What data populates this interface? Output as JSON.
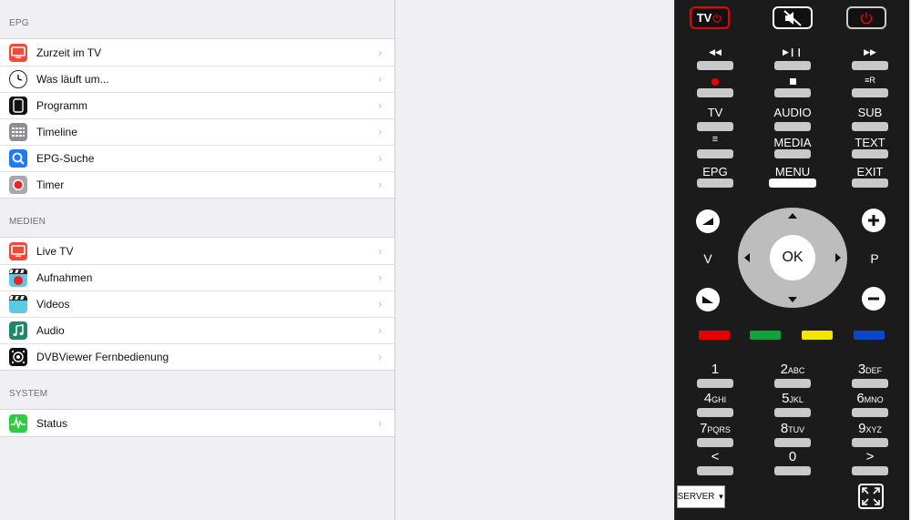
{
  "sections": [
    {
      "header": "EPG",
      "items": [
        {
          "label": "Zurzeit im TV",
          "icon": "tv-icon"
        },
        {
          "label": "Was läuft um...",
          "icon": "clock-icon"
        },
        {
          "label": "Programm",
          "icon": "program-icon"
        },
        {
          "label": "Timeline",
          "icon": "timeline-icon"
        },
        {
          "label": "EPG-Suche",
          "icon": "search-icon"
        },
        {
          "label": "Timer",
          "icon": "record-icon"
        }
      ]
    },
    {
      "header": "MEDIEN",
      "items": [
        {
          "label": "Live TV",
          "icon": "tv-icon"
        },
        {
          "label": "Aufnahmen",
          "icon": "clapper-record-icon"
        },
        {
          "label": "Videos",
          "icon": "clapper-icon"
        },
        {
          "label": "Audio",
          "icon": "music-note-icon"
        },
        {
          "label": "DVBViewer Fernbedienung",
          "icon": "remote-icon"
        }
      ]
    },
    {
      "header": "SYSTEM",
      "items": [
        {
          "label": "Status",
          "icon": "status-icon"
        }
      ]
    }
  ],
  "remote": {
    "tv_power_label": "TV",
    "rows": {
      "row1": [
        "",
        "",
        ""
      ],
      "row3": [
        "TV",
        "AUDIO",
        "SUB"
      ],
      "row4": [
        "",
        "MEDIA",
        "TEXT"
      ],
      "row5": [
        "EPG",
        "MENU",
        "EXIT"
      ]
    },
    "ok_label": "OK",
    "volume_label": "V",
    "program_label": "P",
    "colors": [
      "#e60000",
      "#12a340",
      "#f2e500",
      "#0d47c9"
    ],
    "numpad": [
      {
        "digit": "1",
        "letters": ""
      },
      {
        "digit": "2",
        "letters": "ABC"
      },
      {
        "digit": "3",
        "letters": "DEF"
      },
      {
        "digit": "4",
        "letters": "GHI"
      },
      {
        "digit": "5",
        "letters": "JKL"
      },
      {
        "digit": "6",
        "letters": "MNO"
      },
      {
        "digit": "7",
        "letters": "PQRS"
      },
      {
        "digit": "8",
        "letters": "TUV"
      },
      {
        "digit": "9",
        "letters": "XYZ"
      },
      {
        "digit": "<",
        "letters": ""
      },
      {
        "digit": "0",
        "letters": ""
      },
      {
        "digit": ">",
        "letters": ""
      }
    ],
    "server_select": "SERVER"
  }
}
